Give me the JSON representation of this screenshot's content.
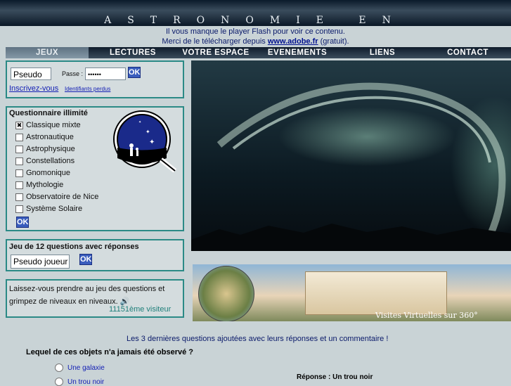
{
  "header": {
    "title": "ASTRONOMIE EN QUESTIONS"
  },
  "flash": {
    "line1": "Il vous manque le player Flash pour voir ce contenu.",
    "line2_pre": "Merci de le télécharger depuis ",
    "line2_link": "www.adobe.fr",
    "line2_post": " (gratuit)."
  },
  "nav": {
    "items": [
      "JEUX",
      "LECTURES",
      "VOTRE ESPACE",
      "EVENEMENTS",
      "LIENS",
      "CONTACT"
    ],
    "active": "JEUX"
  },
  "login": {
    "pseudo_value": "Pseudo",
    "pass_label": "Passe :",
    "pass_value": "••••••",
    "ok_label": "OK",
    "register_link": "Inscrivez-vous",
    "lost_link": "Identifiants perdus"
  },
  "quiz": {
    "title": "Questionnaire illimité",
    "options": [
      {
        "label": "Classique mixte",
        "checked": true
      },
      {
        "label": "Astronautique",
        "checked": false
      },
      {
        "label": "Astrophysique",
        "checked": false
      },
      {
        "label": "Constellations",
        "checked": false
      },
      {
        "label": "Gnomonique",
        "checked": false
      },
      {
        "label": "Mythologie",
        "checked": false
      },
      {
        "label": "Observatoire de Nice",
        "checked": false
      },
      {
        "label": "Système Solaire",
        "checked": false
      }
    ],
    "ok_label": "OK"
  },
  "game12": {
    "title": "Jeu de 12 questions avec réponses",
    "pseudo_value": "Pseudo joueur",
    "ok_label": "OK"
  },
  "promo": {
    "text": "Laissez-vous prendre au jeu des questions et grimpez de niveaux en niveaux.",
    "visitor": "11151ème visiteur"
  },
  "banner": {
    "caption": "Visites Virtuelles sur 360°"
  },
  "recent": {
    "intro": "Les 3 dernières questions ajoutées avec leurs réponses et un commentaire !",
    "question": "Lequel de ces objets n'a jamais été observé ?",
    "answers": [
      "Une galaxie",
      "Un trou noir"
    ],
    "response": "Réponse : Un trou noir"
  }
}
